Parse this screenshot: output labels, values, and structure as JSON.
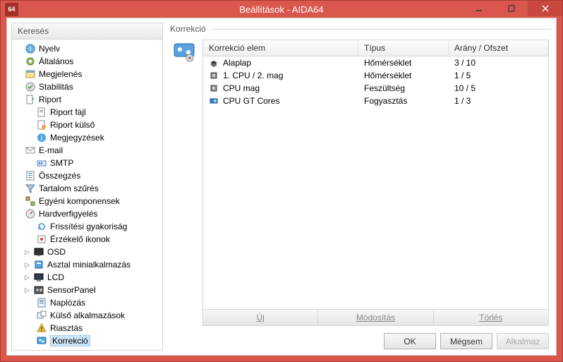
{
  "window": {
    "title": "Beállítások - AIDA64"
  },
  "sidebar": {
    "header": "Keresés",
    "items": [
      {
        "label": "Nyelv"
      },
      {
        "label": "Általános"
      },
      {
        "label": "Megjelenés"
      },
      {
        "label": "Stabilitás"
      },
      {
        "label": "Riport"
      },
      {
        "label": "Riport fájl"
      },
      {
        "label": "Riport külső"
      },
      {
        "label": "Megjegyzések"
      },
      {
        "label": "E-mail"
      },
      {
        "label": "SMTP"
      },
      {
        "label": "Összegzés"
      },
      {
        "label": "Tartalom szűrés"
      },
      {
        "label": "Egyéni komponensek"
      },
      {
        "label": "Hardverfigyelés"
      },
      {
        "label": "Frissítési gyakoriság"
      },
      {
        "label": "Érzékelő ikonok"
      },
      {
        "label": "OSD"
      },
      {
        "label": "Asztal minialkalmazás"
      },
      {
        "label": "LCD"
      },
      {
        "label": "SensorPanel"
      },
      {
        "label": "Naplózás"
      },
      {
        "label": "Külső alkalmazások"
      },
      {
        "label": "Riasztás"
      },
      {
        "label": "Korrekció"
      }
    ]
  },
  "main": {
    "section_title": "Korrekció",
    "columns": {
      "c1": "Korrekció elem",
      "c2": "Típus",
      "c3": "Arány / Ofszet"
    },
    "rows": [
      {
        "elem": "Alaplap",
        "type": "Hőmérséklet",
        "ratio": "3 / 10"
      },
      {
        "elem": "1. CPU / 2. mag",
        "type": "Hőmérséklet",
        "ratio": "1 / 5"
      },
      {
        "elem": "CPU mag",
        "type": "Feszültség",
        "ratio": "10 / 5"
      },
      {
        "elem": "CPU GT Cores",
        "type": "Fogyasztás",
        "ratio": "1 / 3"
      }
    ],
    "buttons": {
      "new": "Új",
      "modify": "Módosítás",
      "delete": "Törlés"
    }
  },
  "footer": {
    "ok": "OK",
    "cancel": "Mégsem",
    "apply": "Alkalmaz"
  }
}
